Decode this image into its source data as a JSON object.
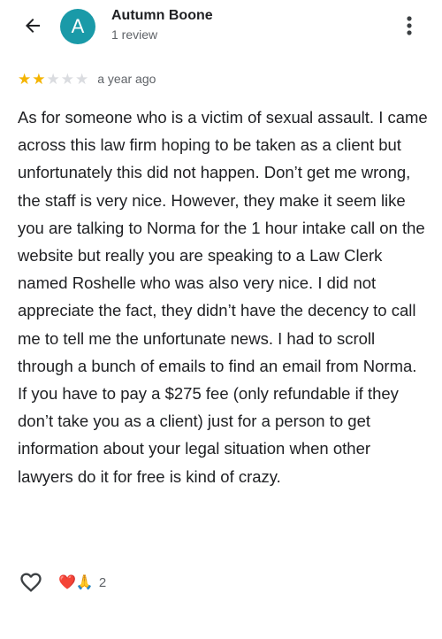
{
  "header": {
    "back_icon": "arrow-back-icon",
    "avatar_letter": "A",
    "avatar_color": "#1a9aa8",
    "author_name": "Autumn Boone",
    "author_meta": "1 review",
    "more_icon": "more-vert-icon"
  },
  "review": {
    "rating": 2,
    "rating_max": 5,
    "star_color": "#f4b400",
    "time": "a year ago",
    "text": "As for someone who is a victim of sexual assault. I came across this law firm hoping to be taken as a client but unfortunately this did not happen. Don’t get me wrong, the staff is very nice. However, they make it seem like you are talking to Norma for the 1 hour intake call on the website but really you are speaking to a Law Clerk named Roshelle who was also very nice. I did not appreciate the fact, they didn’t have the decency to call me to tell me the unfortunate news. I had to scroll through a bunch of emails to find an email from Norma. If you have to pay a $275 fee (only refundable if they don’t take you as a client) just for a person to get information about your legal situation when other lawyers do it for free is kind of crazy."
  },
  "actions": {
    "like_icon": "heart-outline-icon",
    "reactions": [
      "❤️",
      "🙏"
    ],
    "reaction_count": "2"
  }
}
